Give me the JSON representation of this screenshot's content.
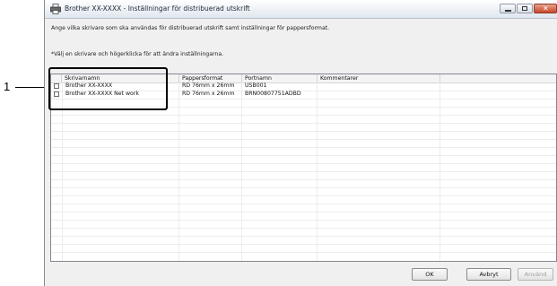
{
  "window": {
    "title": "Brother XX-XXXX - Inställningar för distribuerad utskrift"
  },
  "instructions": {
    "line1": "Ange vilka skrivare som ska användas för distribuerad utskrift samt inställningar för pappersformat.",
    "line2": "*Välj en skrivare och högerklicka för att ändra inställningarna."
  },
  "table": {
    "columns": [
      "Skrivarnamn",
      "Pappersformat",
      "Portnamn",
      "Kommentarer"
    ],
    "rows": [
      {
        "name": "Brother XX-XXXX",
        "paper": "RD 76mm x 26mm",
        "port": "USB001",
        "comment": ""
      },
      {
        "name": "Brother XX-XXXX Net work",
        "paper": "RD 76mm x 26mm",
        "port": "BRN00807751ADBD",
        "comment": ""
      }
    ]
  },
  "buttons": {
    "ok": "OK",
    "cancel": "Avbryt",
    "apply": "Använd"
  },
  "callout": {
    "number": "1"
  }
}
